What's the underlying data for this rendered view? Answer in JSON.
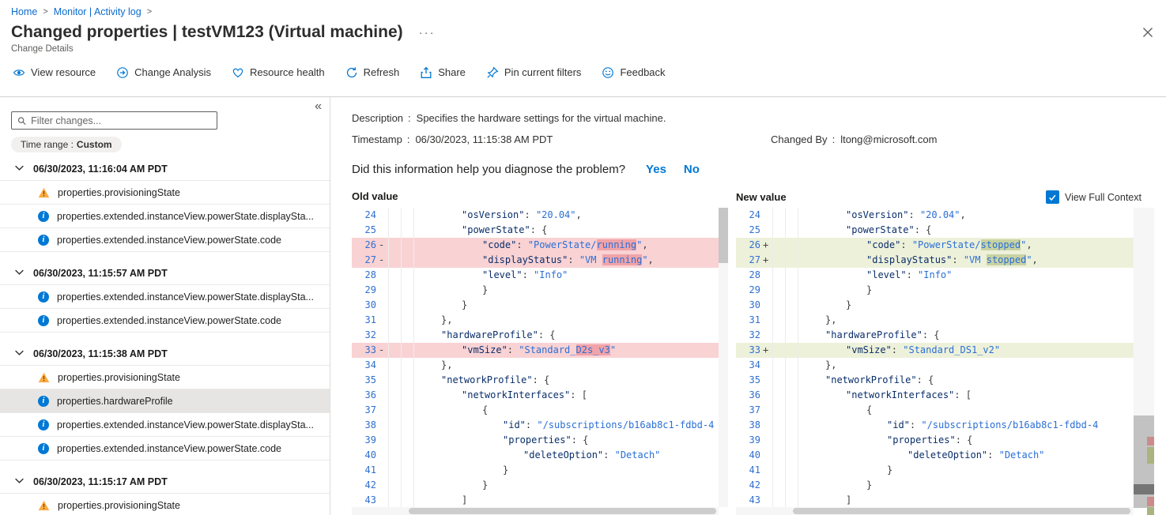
{
  "colors": {
    "accent": "#0078d4",
    "removed_line_bg": "#f9d2d4",
    "removed_word_bg": "#f0a3a8",
    "added_line_bg": "#edf1da",
    "added_word_bg": "#c8d2a2"
  },
  "breadcrumb": {
    "home": "Home",
    "section": "Monitor | Activity log"
  },
  "header": {
    "title": "Changed properties | testVM123 (Virtual machine)",
    "subtitle": "Change Details",
    "more": "···"
  },
  "toolbar": {
    "items": [
      {
        "id": "view-resource",
        "label": "View resource"
      },
      {
        "id": "change-analysis",
        "label": "Change Analysis"
      },
      {
        "id": "resource-health",
        "label": "Resource health"
      },
      {
        "id": "refresh",
        "label": "Refresh"
      },
      {
        "id": "share",
        "label": "Share"
      },
      {
        "id": "pin-current-filters",
        "label": "Pin current filters"
      },
      {
        "id": "feedback",
        "label": "Feedback"
      }
    ]
  },
  "sidebar": {
    "filter_placeholder": "Filter changes...",
    "time_range_label": "Time range :",
    "time_range_value": "Custom",
    "groups": [
      {
        "timestamp": "06/30/2023, 11:16:04 AM PDT",
        "items": [
          {
            "icon": "warning",
            "label": "properties.provisioningState"
          },
          {
            "icon": "info",
            "label": "properties.extended.instanceView.powerState.displaySta..."
          },
          {
            "icon": "info",
            "label": "properties.extended.instanceView.powerState.code"
          }
        ]
      },
      {
        "timestamp": "06/30/2023, 11:15:57 AM PDT",
        "items": [
          {
            "icon": "info",
            "label": "properties.extended.instanceView.powerState.displaySta..."
          },
          {
            "icon": "info",
            "label": "properties.extended.instanceView.powerState.code"
          }
        ]
      },
      {
        "timestamp": "06/30/2023, 11:15:38 AM PDT",
        "items": [
          {
            "icon": "warning",
            "label": "properties.provisioningState"
          },
          {
            "icon": "info",
            "label": "properties.hardwareProfile",
            "selected": true
          },
          {
            "icon": "info",
            "label": "properties.extended.instanceView.powerState.displaySta..."
          },
          {
            "icon": "info",
            "label": "properties.extended.instanceView.powerState.code"
          }
        ]
      },
      {
        "timestamp": "06/30/2023, 11:15:17 AM PDT",
        "items": [
          {
            "icon": "warning",
            "label": "properties.provisioningState"
          }
        ]
      }
    ]
  },
  "details": {
    "colon": ":",
    "description_label": "Description",
    "description_value": "Specifies the hardware settings for the virtual machine.",
    "timestamp_label": "Timestamp",
    "timestamp_value": "06/30/2023, 11:15:38 AM PDT",
    "changed_by_label": "Changed By",
    "changed_by_value": "ltong@microsoft.com"
  },
  "feedback": {
    "question": "Did this information help you diagnose the problem?",
    "yes": "Yes",
    "no": "No"
  },
  "diff": {
    "old_title": "Old value",
    "new_title": "New value",
    "context_label": "View Full Context",
    "context_checked": true,
    "old_lines": [
      {
        "n": 24,
        "d": "",
        "i": 2,
        "c": "\"osVersion\": \"20.04\","
      },
      {
        "n": 25,
        "d": "",
        "i": 2,
        "c": "\"powerState\": {"
      },
      {
        "n": 26,
        "d": "-",
        "i": 3,
        "c": "\"code\": \"PowerState/running\",",
        "hl": "running"
      },
      {
        "n": 27,
        "d": "-",
        "i": 3,
        "c": "\"displayStatus\": \"VM running\",",
        "hl": "running"
      },
      {
        "n": 28,
        "d": "",
        "i": 3,
        "c": "\"level\": \"Info\""
      },
      {
        "n": 29,
        "d": "",
        "i": 3,
        "c": "}"
      },
      {
        "n": 30,
        "d": "",
        "i": 2,
        "c": "}"
      },
      {
        "n": 31,
        "d": "",
        "i": 1,
        "c": "},"
      },
      {
        "n": 32,
        "d": "",
        "i": 1,
        "c": "\"hardwareProfile\": {"
      },
      {
        "n": 33,
        "d": "-",
        "i": 2,
        "c": "\"vmSize\": \"Standard_D2s_v3\"",
        "hl": "D2s_v3"
      },
      {
        "n": 34,
        "d": "",
        "i": 1,
        "c": "},"
      },
      {
        "n": 35,
        "d": "",
        "i": 1,
        "c": "\"networkProfile\": {"
      },
      {
        "n": 36,
        "d": "",
        "i": 2,
        "c": "\"networkInterfaces\": ["
      },
      {
        "n": 37,
        "d": "",
        "i": 3,
        "c": "{"
      },
      {
        "n": 38,
        "d": "",
        "i": 4,
        "c": "\"id\": \"/subscriptions/b16ab8c1-fdbd-4"
      },
      {
        "n": 39,
        "d": "",
        "i": 4,
        "c": "\"properties\": {"
      },
      {
        "n": 40,
        "d": "",
        "i": 5,
        "c": "\"deleteOption\": \"Detach\""
      },
      {
        "n": 41,
        "d": "",
        "i": 4,
        "c": "}"
      },
      {
        "n": 42,
        "d": "",
        "i": 3,
        "c": "}"
      },
      {
        "n": 43,
        "d": "",
        "i": 2,
        "c": "]"
      }
    ],
    "new_lines": [
      {
        "n": 24,
        "d": "",
        "i": 2,
        "c": "\"osVersion\": \"20.04\","
      },
      {
        "n": 25,
        "d": "",
        "i": 2,
        "c": "\"powerState\": {"
      },
      {
        "n": 26,
        "d": "+",
        "i": 3,
        "c": "\"code\": \"PowerState/stopped\",",
        "hl": "stopped"
      },
      {
        "n": 27,
        "d": "+",
        "i": 3,
        "c": "\"displayStatus\": \"VM stopped\",",
        "hl": "stopped"
      },
      {
        "n": 28,
        "d": "",
        "i": 3,
        "c": "\"level\": \"Info\""
      },
      {
        "n": 29,
        "d": "",
        "i": 3,
        "c": "}"
      },
      {
        "n": 30,
        "d": "",
        "i": 2,
        "c": "}"
      },
      {
        "n": 31,
        "d": "",
        "i": 1,
        "c": "},"
      },
      {
        "n": 32,
        "d": "",
        "i": 1,
        "c": "\"hardwareProfile\": {"
      },
      {
        "n": 33,
        "d": "+",
        "i": 2,
        "c": "\"vmSize\": \"Standard_DS1_v2\""
      },
      {
        "n": 34,
        "d": "",
        "i": 1,
        "c": "},"
      },
      {
        "n": 35,
        "d": "",
        "i": 1,
        "c": "\"networkProfile\": {"
      },
      {
        "n": 36,
        "d": "",
        "i": 2,
        "c": "\"networkInterfaces\": ["
      },
      {
        "n": 37,
        "d": "",
        "i": 3,
        "c": "{"
      },
      {
        "n": 38,
        "d": "",
        "i": 4,
        "c": "\"id\": \"/subscriptions/b16ab8c1-fdbd-4"
      },
      {
        "n": 39,
        "d": "",
        "i": 4,
        "c": "\"properties\": {"
      },
      {
        "n": 40,
        "d": "",
        "i": 5,
        "c": "\"deleteOption\": \"Detach\""
      },
      {
        "n": 41,
        "d": "",
        "i": 4,
        "c": "}"
      },
      {
        "n": 42,
        "d": "",
        "i": 3,
        "c": "}"
      },
      {
        "n": 43,
        "d": "",
        "i": 2,
        "c": "]"
      }
    ]
  }
}
